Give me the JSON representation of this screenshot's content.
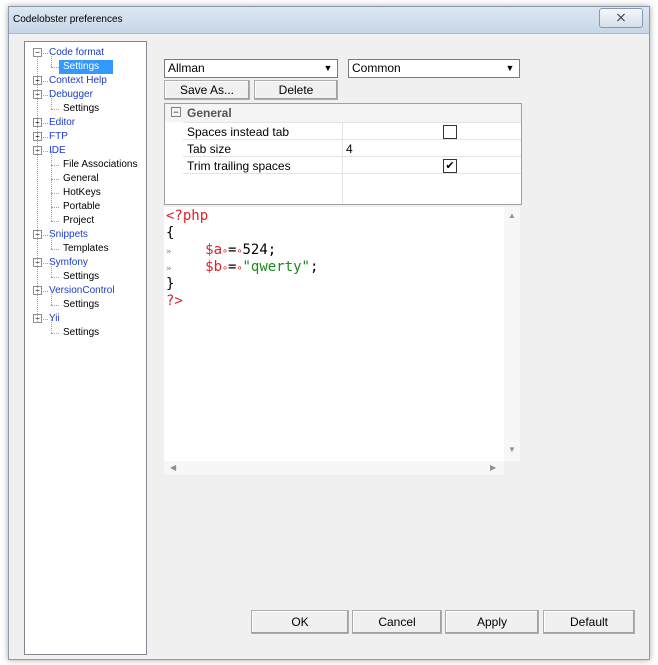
{
  "window": {
    "title": "Codelobster preferences",
    "close_glyph": "⨯"
  },
  "tree": {
    "items": [
      {
        "label": "Code format",
        "level": 0,
        "expander": "⊟",
        "selected": false
      },
      {
        "label": "Settings",
        "level": 1,
        "selected": true
      },
      {
        "label": "Context Help",
        "level": 0,
        "expander": "⊞",
        "selected": false
      },
      {
        "label": "Debugger",
        "level": 0,
        "expander": "⊟",
        "selected": false
      },
      {
        "label": "Settings",
        "level": 1,
        "selected": false
      },
      {
        "label": "Editor",
        "level": 0,
        "expander": "⊞",
        "selected": false
      },
      {
        "label": "FTP",
        "level": 0,
        "expander": "⊞",
        "selected": false
      },
      {
        "label": "IDE",
        "level": 0,
        "expander": "⊟",
        "selected": false
      },
      {
        "label": "File Associations",
        "level": 1,
        "selected": false
      },
      {
        "label": "General",
        "level": 1,
        "selected": false
      },
      {
        "label": "HotKeys",
        "level": 1,
        "selected": false
      },
      {
        "label": "Portable",
        "level": 1,
        "selected": false
      },
      {
        "label": "Project",
        "level": 1,
        "selected": false
      },
      {
        "label": "Snippets",
        "level": 0,
        "expander": "⊟",
        "selected": false
      },
      {
        "label": "Templates",
        "level": 1,
        "selected": false
      },
      {
        "label": "Symfony",
        "level": 0,
        "expander": "⊟",
        "selected": false
      },
      {
        "label": "Settings",
        "level": 1,
        "selected": false
      },
      {
        "label": "VersionControl",
        "level": 0,
        "expander": "⊟",
        "selected": false
      },
      {
        "label": "Settings",
        "level": 1,
        "selected": false
      },
      {
        "label": "Yii",
        "level": 0,
        "expander": "⊟",
        "selected": false
      },
      {
        "label": "Settings",
        "level": 1,
        "selected": false
      }
    ]
  },
  "style_select": {
    "value": "Allman"
  },
  "scope_select": {
    "value": "Common"
  },
  "buttons": {
    "save_as": "Save As...",
    "delete": "Delete",
    "ok": "OK",
    "cancel": "Cancel",
    "apply": "Apply",
    "default": "Default"
  },
  "properties": {
    "category": "General",
    "rows": [
      {
        "key": "Spaces instead tab",
        "value": "",
        "checkbox": true,
        "checked": false
      },
      {
        "key": "Tab size",
        "value": "4",
        "checkbox": false
      },
      {
        "key": "Trim trailing spaces",
        "value": "",
        "checkbox": true,
        "checked": true
      }
    ]
  },
  "preview": {
    "open_tag": "<?php",
    "brace_open": "{",
    "line1_var": "$a",
    "line1_op": "=",
    "line1_val": "524;",
    "line2_var": "$b",
    "line2_op": "=",
    "line2_val": "\"qwerty\"",
    "line2_end": ";",
    "brace_close": "}",
    "close_tag": "?>",
    "tab_marker": "»",
    "space_marker": "∘"
  },
  "icons": {
    "dropdown": "▼",
    "check": "✔",
    "minus": "−",
    "scroll_up": "▲",
    "scroll_down": "▼",
    "scroll_left": "◀",
    "scroll_right": "▶"
  }
}
